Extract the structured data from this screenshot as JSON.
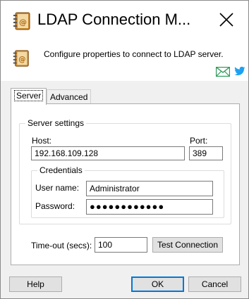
{
  "window": {
    "title": "LDAP Connection M...",
    "description": "Configure properties to connect to LDAP server."
  },
  "tabs": [
    {
      "label": "Server",
      "active": true
    },
    {
      "label": "Advanced",
      "active": false
    }
  ],
  "server_settings": {
    "legend": "Server settings",
    "host_label": "Host:",
    "host_value": "192.168.109.128",
    "port_label": "Port:",
    "port_value": "389"
  },
  "credentials": {
    "legend": "Credentials",
    "username_label": "User name:",
    "username_value": "Administrator",
    "password_label": "Password:",
    "password_value": "●●●●●●●●●●●●"
  },
  "timeout": {
    "label": "Time-out (secs):",
    "value": "100",
    "test_button": "Test Connection"
  },
  "footer": {
    "help": "Help",
    "ok": "OK",
    "cancel": "Cancel"
  },
  "icons": {
    "app": "address-book-icon",
    "close": "close-icon",
    "mail": "mail-icon",
    "twitter": "twitter-icon"
  },
  "colors": {
    "accent": "#0078d7",
    "mail_green": "#2f9a5a",
    "twitter_blue": "#1da1f2"
  }
}
